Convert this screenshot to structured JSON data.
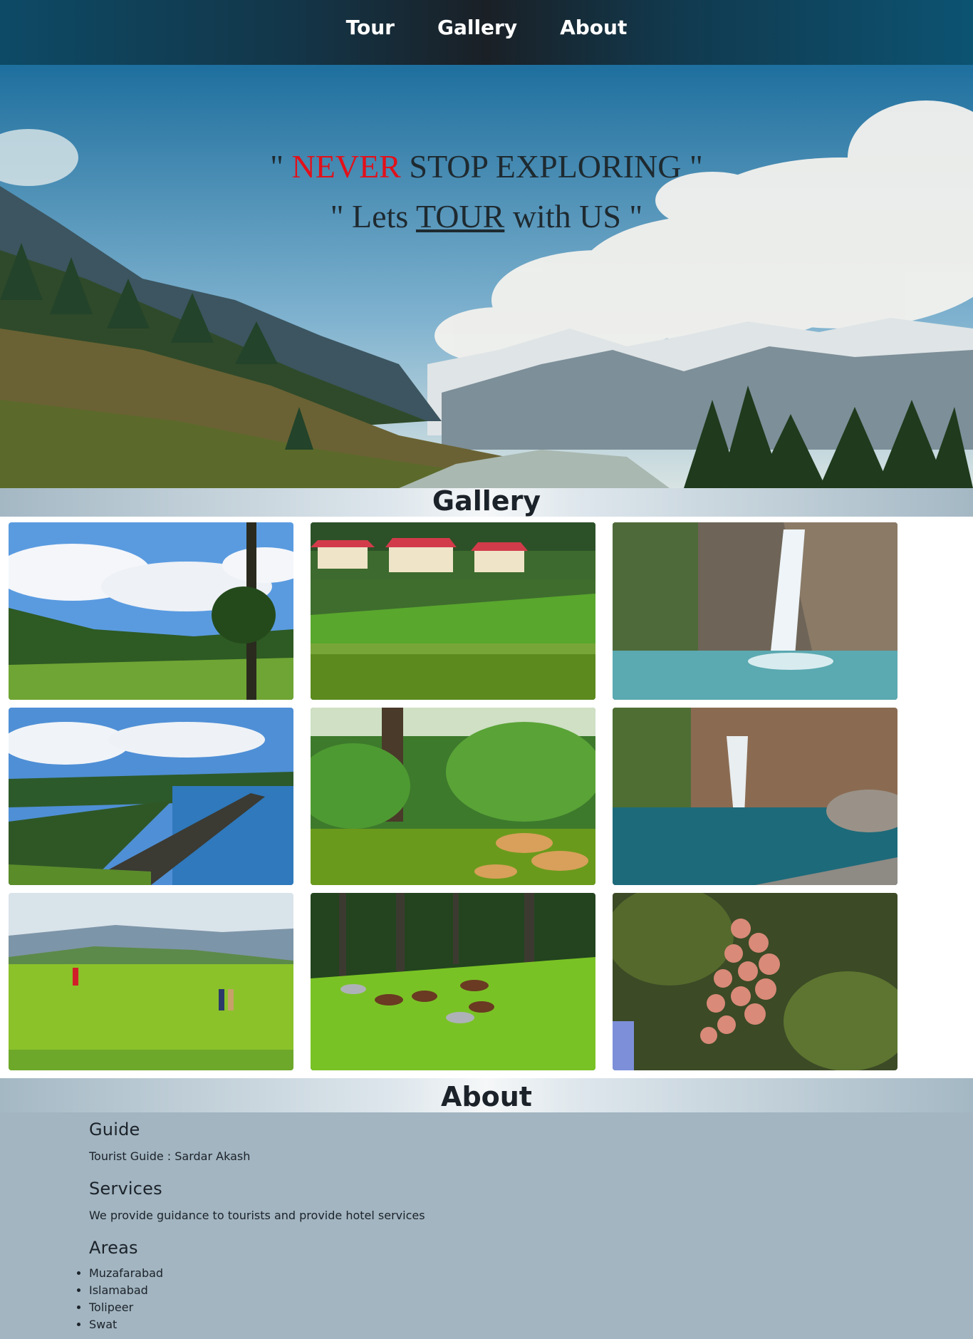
{
  "nav": {
    "items": [
      {
        "label": "Tour"
      },
      {
        "label": "Gallery"
      },
      {
        "label": "About"
      }
    ]
  },
  "hero": {
    "line1_open": "\" ",
    "line1_highlight": "NEVER",
    "line1_rest": " STOP EXPLORING \"",
    "line2_open": "\" Lets ",
    "line2_underlined": "TOUR",
    "line2_rest": " with US \""
  },
  "gallery": {
    "title": "Gallery",
    "photos": [
      "pine-hills-photo",
      "lakeside-huts-photo",
      "waterfall-photo",
      "dam-lake-photo",
      "forest-stream-photo",
      "waterfall-pool-photo",
      "meadow-visitors-photo",
      "grazing-horses-photo",
      "apple-tree-photo"
    ]
  },
  "about": {
    "title": "About",
    "guide_heading": "Guide",
    "guide_text": "Tourist Guide : Sardar Akash",
    "services_heading": "Services",
    "services_text": "We provide guidance to tourists and provide hotel services",
    "areas_heading": "Areas",
    "areas": [
      "Muzafarabad",
      "Islamabad",
      "Tolipeer",
      "Swat"
    ]
  },
  "colors": {
    "accent_red": "#e3101a",
    "about_bg": "#a2b5c1"
  }
}
